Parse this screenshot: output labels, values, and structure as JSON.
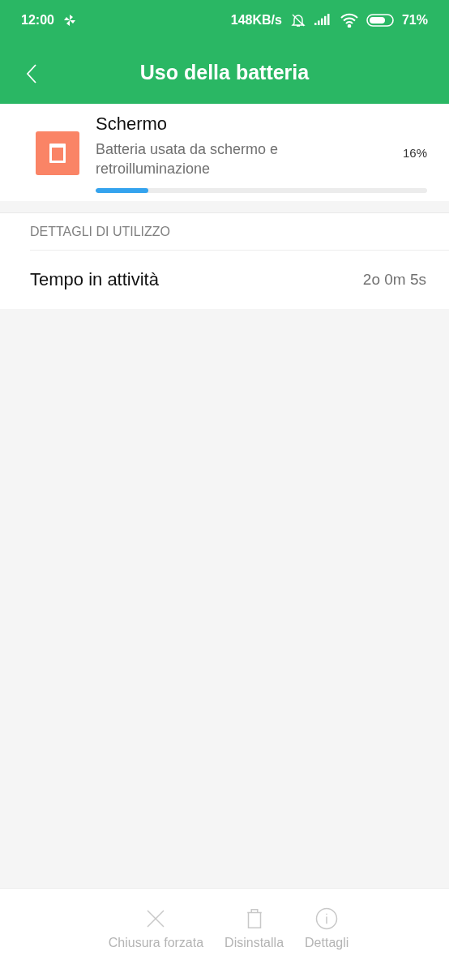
{
  "status_bar": {
    "time": "12:00",
    "network_speed": "148KB/s",
    "battery": "71%"
  },
  "app_bar": {
    "title": "Uso della batteria"
  },
  "usage_item": {
    "name": "Schermo",
    "description": "Batteria usata da schermo e retroilluminazione",
    "percent": "16%",
    "level": 0.16
  },
  "section": {
    "header": "DETTAGLI DI UTILIZZO",
    "rows": [
      {
        "label": "Tempo in attività",
        "value": "2o 0m 5s"
      }
    ]
  },
  "bottom_actions": [
    {
      "kind": "close",
      "label": "Chiusura forzata",
      "disabled": true
    },
    {
      "kind": "trash",
      "label": "Disinstalla",
      "disabled": true
    },
    {
      "kind": "info",
      "label": "Dettagli",
      "disabled": true
    }
  ]
}
